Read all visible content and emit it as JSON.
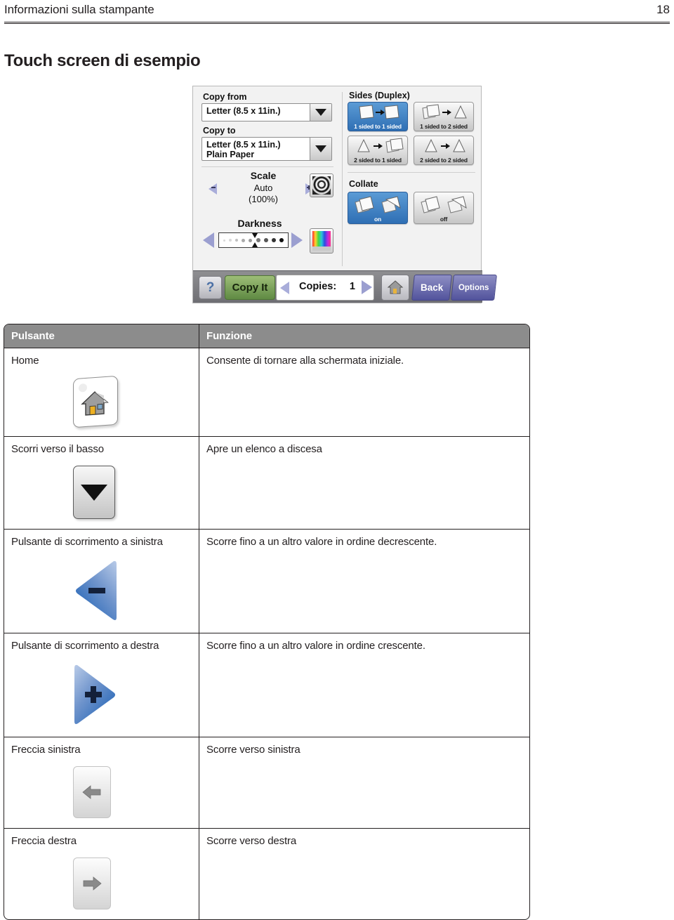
{
  "header": {
    "title": "Informazioni sulla stampante",
    "page_number": "18"
  },
  "section": {
    "heading": "Touch screen di esempio"
  },
  "touch_panel": {
    "copy_from": {
      "label": "Copy from",
      "value": "Letter (8.5 x 11in.)",
      "arrow_icon": "chevron-down-icon"
    },
    "copy_to": {
      "label": "Copy to",
      "value": "Letter (8.5 x 11in.)\nPlain Paper",
      "arrow_icon": "chevron-down-icon"
    },
    "scale": {
      "label": "Scale",
      "value": "Auto",
      "percent": "(100%)",
      "decrease_label": "-",
      "increase_label": "+"
    },
    "darkness": {
      "label": "Darkness"
    },
    "sides": {
      "title": "Sides (Duplex)",
      "options": [
        {
          "caption": "1 sided to 1 sided",
          "selected": true
        },
        {
          "caption": "1 sided to 2 sided",
          "selected": false
        },
        {
          "caption": "2 sided to 1 sided",
          "selected": false
        },
        {
          "caption": "2 sided to 2 sided",
          "selected": false
        }
      ]
    },
    "collate": {
      "title": "Collate",
      "options": [
        {
          "caption": "on",
          "selected": true
        },
        {
          "caption": "off",
          "selected": false
        }
      ]
    },
    "toolbar": {
      "help_label": "?",
      "copy_it_label": "Copy It",
      "copies_label": "Copies:",
      "copies_value": "1",
      "home_icon": "home-icon",
      "back_label": "Back",
      "options_label": "Options"
    },
    "colors": {
      "selected_tile": "#3d7ec0",
      "toolbar_bg": "#7b7b80",
      "copy_it_green": "#7da35c",
      "nav_purple": "#6a6bae"
    }
  },
  "table": {
    "columns": [
      "Pulsante",
      "Funzione"
    ],
    "rows": [
      {
        "button": "Home",
        "icon": "home-button-icon",
        "function": "Consente di tornare alla schermata iniziale."
      },
      {
        "button": "Scorri verso il basso",
        "icon": "scroll-down-button-icon",
        "function": "Apre un elenco a discesa"
      },
      {
        "button": "Pulsante di scorrimento a sinistra",
        "icon": "scroll-left-minus-icon",
        "function": "Scorre fino a un altro valore in ordine decrescente."
      },
      {
        "button": "Pulsante di scorrimento a destra",
        "icon": "scroll-right-plus-icon",
        "function": "Scorre fino a un altro valore in ordine crescente."
      },
      {
        "button": "Freccia sinistra",
        "icon": "left-arrow-icon",
        "function": "Scorre verso sinistra"
      },
      {
        "button": "Freccia destra",
        "icon": "right-arrow-icon",
        "function": "Scorre verso destra"
      }
    ]
  }
}
